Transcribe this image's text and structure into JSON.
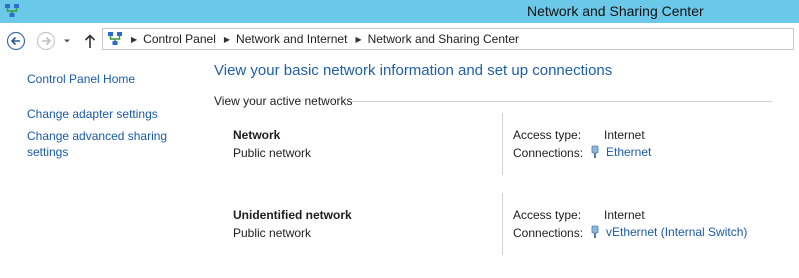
{
  "window": {
    "title": "Network and Sharing Center",
    "icon": "network-center-icon",
    "titlebar_color": "#6cc8e8"
  },
  "nav": {
    "back_icon": "back-arrow-icon",
    "forward_icon": "forward-arrow-icon",
    "recent_icon": "chevron-down-icon",
    "up_icon": "up-arrow-icon",
    "breadcrumbs": [
      "Control Panel",
      "Network and Internet",
      "Network and Sharing Center"
    ]
  },
  "sidebar": {
    "items": [
      {
        "label": "Control Panel Home"
      },
      {
        "label": "Change adapter settings"
      },
      {
        "label": "Change advanced sharing settings"
      }
    ]
  },
  "main": {
    "heading": "View your basic network information and set up connections",
    "section_label": "View your active networks",
    "networks": [
      {
        "name": "Network",
        "category": "Public network",
        "access_type_label": "Access type:",
        "access_type": "Internet",
        "connections_label": "Connections:",
        "connection": "Ethernet",
        "connection_icon": "ethernet-icon"
      },
      {
        "name": "Unidentified network",
        "category": "Public network",
        "access_type_label": "Access type:",
        "access_type": "Internet",
        "connections_label": "Connections:",
        "connection": "vEthernet (Internal Switch)",
        "connection_icon": "ethernet-icon"
      }
    ]
  },
  "colors": {
    "link": "#1a5aa6",
    "heading": "#1e5fa8"
  }
}
